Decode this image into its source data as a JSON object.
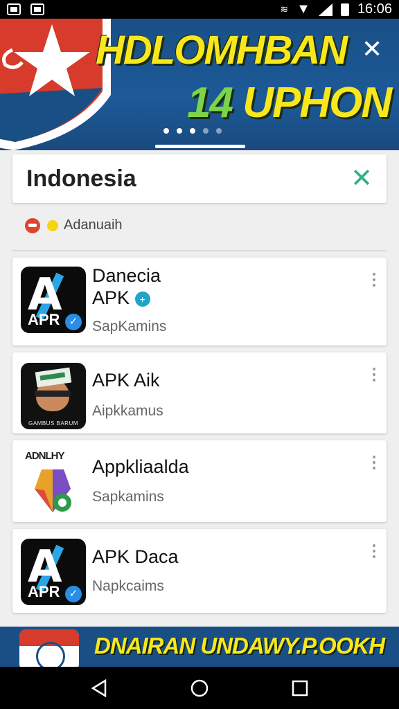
{
  "status_bar": {
    "time": "16:06"
  },
  "banner": {
    "headline_line1": "HDLOMHBAN",
    "headline_num": "14",
    "headline_word": " UPHON",
    "close_icon": "close-icon",
    "carousel_dots": 5,
    "active_dot": 0
  },
  "search": {
    "query": "Indonesia",
    "clear_icon": "close-icon"
  },
  "filter": {
    "label": "Adanuaih"
  },
  "apps": [
    {
      "name_line1": "Danecia",
      "name_line2": "APK",
      "subtitle": "SapKamins",
      "icon": "apr-logo",
      "verified": true
    },
    {
      "name_line1": "APK Aik",
      "subtitle": "Aipkkamus",
      "icon": "face-logo",
      "icon_caption": "GAMBUS BARUM"
    },
    {
      "name_line1": "Appkliaalda",
      "subtitle": "Sapkamins",
      "icon": "map-pin-logo",
      "icon_tag": "ADNLHY"
    },
    {
      "name_line1": "APK Daca",
      "subtitle": "Napkcaims",
      "icon": "apr-logo"
    }
  ],
  "ad": {
    "text": "DNAIRAN UNDAWY.P.OOKH"
  },
  "colors": {
    "banner_bg": "#1c5a98",
    "headline_yellow": "#f8e71c",
    "accent_green": "#2db08a"
  }
}
